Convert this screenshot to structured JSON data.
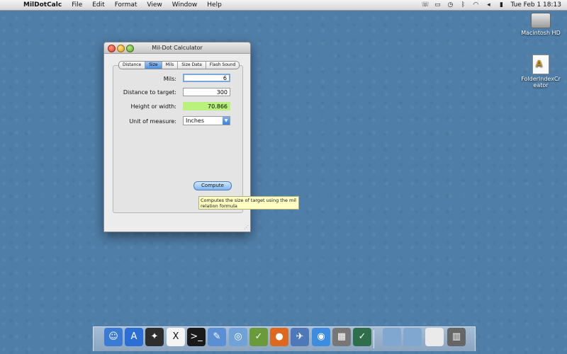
{
  "menubar": {
    "apple_icon": "",
    "app_name": "MilDotCalc",
    "menus": [
      "File",
      "Edit",
      "Format",
      "View",
      "Window",
      "Help"
    ],
    "clock": "Tue Feb 1  18:13"
  },
  "desktop": {
    "icons": [
      {
        "label": "Macintosh HD",
        "icon": "hard-drive-icon"
      },
      {
        "label": "FolderIndexCreator",
        "icon": "app-icon"
      }
    ]
  },
  "window": {
    "title": "Mil-Dot Calculator",
    "tabs": [
      "Distance",
      "Size",
      "Mils",
      "Size Data",
      "Flash Sound"
    ],
    "active_tab": "Size",
    "fields": {
      "mils_label": "Mils:",
      "mils_value": "6",
      "distance_label": "Distance to target:",
      "distance_value": "300",
      "height_label": "Height or width:",
      "height_value": "70.866",
      "unit_label": "Unit of measure:",
      "unit_value": "Inches"
    },
    "compute_label": "Compute",
    "tooltip": "Computes the size of target using the mil relation formula"
  },
  "dock": {
    "items": [
      "finder-icon",
      "appstore-icon",
      "launchpad-icon",
      "x11-icon",
      "terminal-icon",
      "xcode-icon",
      "network-icon",
      "editor-icon",
      "firefox-icon",
      "preview-icon",
      "safari-icon",
      "photo-icon",
      "time-machine-icon",
      "folder-icon",
      "folder-icon",
      "document-icon",
      "trash-icon"
    ]
  }
}
